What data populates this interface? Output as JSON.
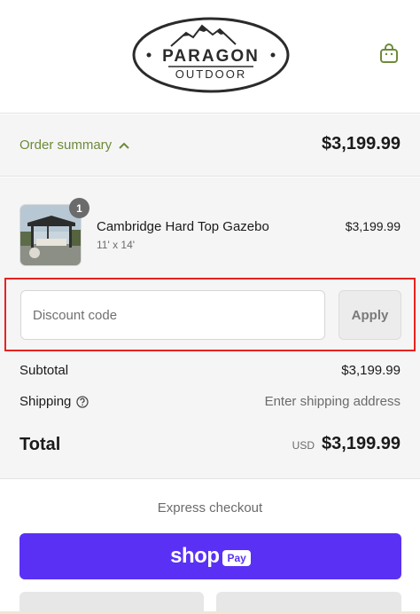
{
  "header": {
    "brand_name": "PARAGON",
    "brand_sub": "OUTDOOR",
    "cart_icon": "shopping-bag-icon"
  },
  "summary": {
    "toggle_label": "Order summary",
    "toggle_icon": "chevron-up-icon",
    "toggle_total": "$3,199.99"
  },
  "product": {
    "quantity": "1",
    "name": "Cambridge Hard Top Gazebo",
    "variant": "11' x 14'",
    "price": "$3,199.99"
  },
  "discount": {
    "placeholder": "Discount code",
    "apply_label": "Apply"
  },
  "totals": {
    "subtotal_label": "Subtotal",
    "subtotal_value": "$3,199.99",
    "shipping_label": "Shipping",
    "shipping_value": "Enter shipping address",
    "total_label": "Total",
    "currency": "USD",
    "total_value": "$3,199.99"
  },
  "express": {
    "title": "Express checkout",
    "shop_label": "shop",
    "pay_label": "Pay"
  },
  "colors": {
    "accent_green": "#6d8b3a",
    "shop_pay_purple": "#5a31f4",
    "highlight_red": "#e8221e"
  }
}
